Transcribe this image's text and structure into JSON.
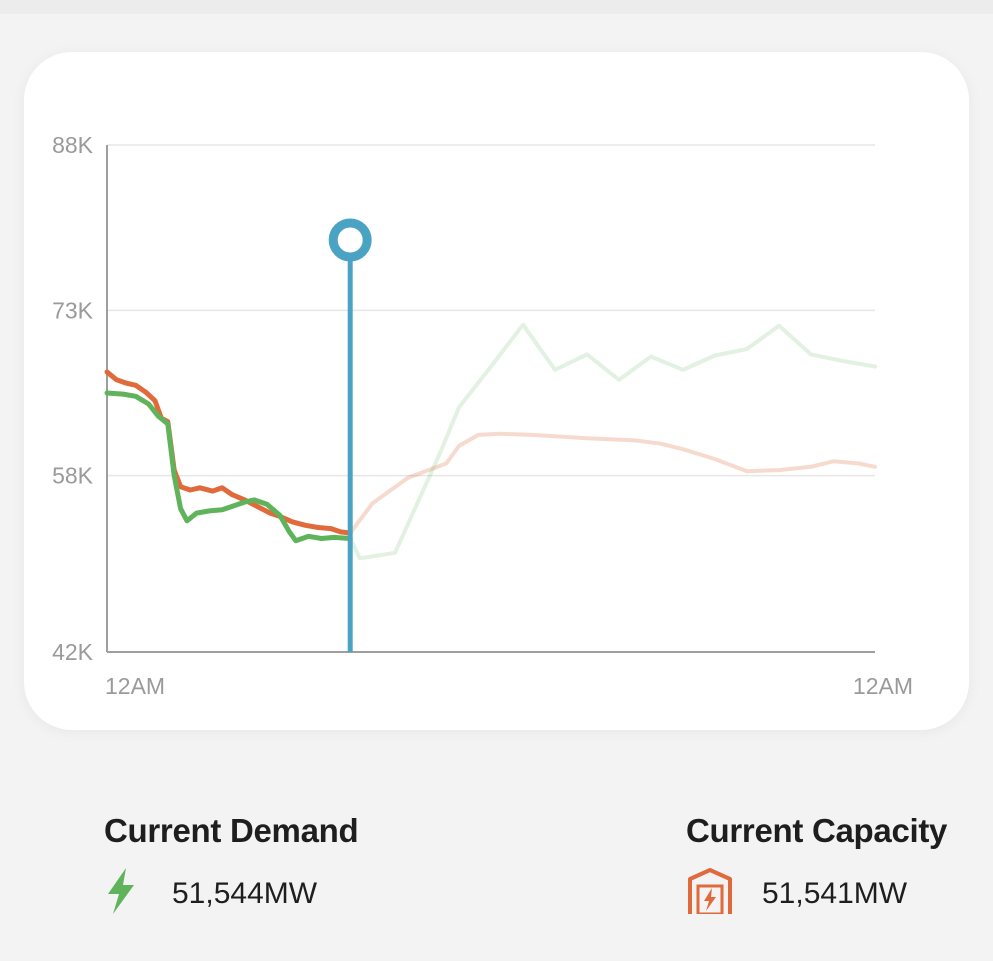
{
  "chart_data": {
    "type": "line",
    "y_ticks": [
      "88K",
      "73K",
      "58K",
      "42K"
    ],
    "x_ticks": [
      "12AM",
      "12AM"
    ],
    "ylim": [
      42000,
      88000
    ],
    "x_unit": "hours since midnight",
    "xlim": [
      0,
      24
    ],
    "grid": true,
    "current_time_hours": 7.6,
    "series": [
      {
        "color": "#e06a3b",
        "values": [
          [
            0,
            67400
          ],
          [
            0.3,
            66700
          ],
          [
            0.6,
            66400
          ],
          [
            0.9,
            66200
          ],
          [
            1.2,
            65600
          ],
          [
            1.5,
            64800
          ],
          [
            1.7,
            63200
          ],
          [
            1.9,
            62900
          ],
          [
            2.1,
            58500
          ],
          [
            2.3,
            57000
          ],
          [
            2.6,
            56700
          ],
          [
            2.9,
            56900
          ],
          [
            3.3,
            56600
          ],
          [
            3.6,
            56900
          ],
          [
            3.9,
            56300
          ],
          [
            4.3,
            55800
          ],
          [
            4.7,
            55200
          ],
          [
            5.1,
            54600
          ],
          [
            5.4,
            54300
          ],
          [
            5.8,
            53800
          ],
          [
            6.2,
            53500
          ],
          [
            6.6,
            53300
          ],
          [
            7.0,
            53200
          ],
          [
            7.3,
            52900
          ],
          [
            7.6,
            52800
          ]
        ]
      },
      {
        "color": "#e06a3b",
        "values": [
          [
            7.6,
            52800
          ],
          [
            8.3,
            55500
          ],
          [
            9.4,
            57800
          ],
          [
            10.6,
            59100
          ],
          [
            11.0,
            60700
          ],
          [
            11.6,
            61700
          ],
          [
            12.3,
            61800
          ],
          [
            13.3,
            61700
          ],
          [
            15.0,
            61400
          ],
          [
            16.5,
            61200
          ],
          [
            17.3,
            60900
          ],
          [
            18.0,
            60400
          ],
          [
            19.0,
            59500
          ],
          [
            20.0,
            58400
          ],
          [
            21.0,
            58500
          ],
          [
            22.0,
            58800
          ],
          [
            22.7,
            59300
          ],
          [
            23.5,
            59100
          ],
          [
            24.0,
            58800
          ]
        ]
      },
      {
        "color": "#5fb35b",
        "values": [
          [
            0,
            65500
          ],
          [
            0.5,
            65400
          ],
          [
            0.9,
            65200
          ],
          [
            1.3,
            64500
          ],
          [
            1.6,
            63400
          ],
          [
            1.9,
            62700
          ],
          [
            2.1,
            58000
          ],
          [
            2.3,
            55000
          ],
          [
            2.5,
            53900
          ],
          [
            2.8,
            54600
          ],
          [
            3.2,
            54800
          ],
          [
            3.6,
            54900
          ],
          [
            3.9,
            55200
          ],
          [
            4.3,
            55600
          ],
          [
            4.6,
            55800
          ],
          [
            5.0,
            55400
          ],
          [
            5.4,
            54400
          ],
          [
            5.7,
            52900
          ],
          [
            5.9,
            52100
          ],
          [
            6.3,
            52500
          ],
          [
            6.7,
            52300
          ],
          [
            7.1,
            52400
          ],
          [
            7.6,
            52300
          ]
        ]
      },
      {
        "color": "#5fb35b",
        "values": [
          [
            7.6,
            52300
          ],
          [
            7.9,
            50500
          ],
          [
            9.0,
            51000
          ],
          [
            10.4,
            60000
          ],
          [
            11.0,
            64200
          ],
          [
            12.0,
            67900
          ],
          [
            13.0,
            71700
          ],
          [
            14.0,
            67600
          ],
          [
            15.0,
            69000
          ],
          [
            16.0,
            66700
          ],
          [
            17.0,
            68800
          ],
          [
            18.0,
            67600
          ],
          [
            19.0,
            68900
          ],
          [
            20.0,
            69500
          ],
          [
            21.0,
            71600
          ],
          [
            22.0,
            69000
          ],
          [
            23.0,
            68400
          ],
          [
            24.0,
            67900
          ]
        ]
      }
    ]
  },
  "stats": {
    "demand": {
      "title": "Current Demand",
      "value": "51,544MW",
      "icon": "lightning-bolt-icon",
      "color": "#5fb35b"
    },
    "capacity": {
      "title": "Current Capacity",
      "value": "51,541MW",
      "icon": "power-plant-icon",
      "color": "#e06a3b"
    }
  },
  "colors": {
    "marker": "#4aa3c3",
    "grid": "#e6e6e6",
    "axis": "#9e9e9e"
  }
}
